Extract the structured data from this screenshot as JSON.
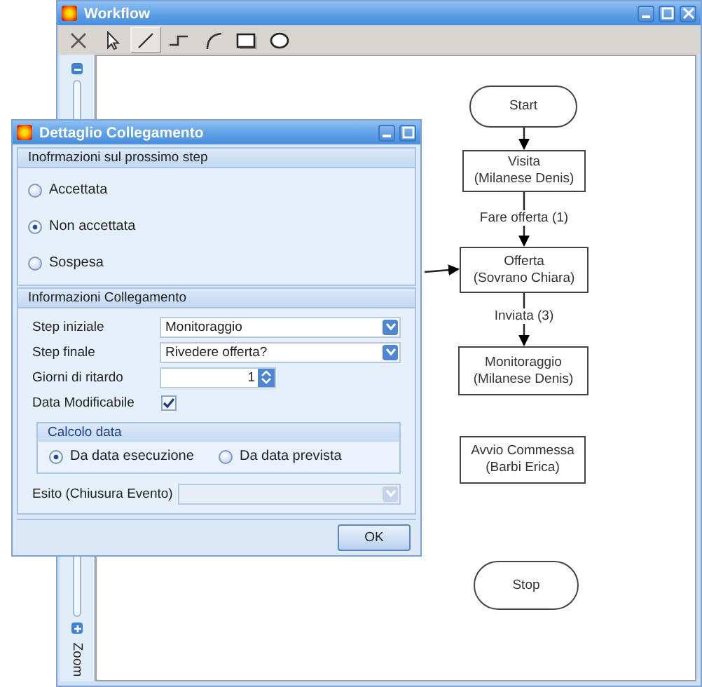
{
  "workflow": {
    "title": "Workflow",
    "tools": [
      {
        "kind": "delete",
        "selected": false
      },
      {
        "kind": "pointer",
        "selected": false
      },
      {
        "kind": "line",
        "selected": true
      },
      {
        "kind": "elbow",
        "selected": false
      },
      {
        "kind": "arc",
        "selected": false
      },
      {
        "kind": "rectangle",
        "selected": false
      },
      {
        "kind": "ellipse",
        "selected": false
      }
    ],
    "zoom_label": "Zoom",
    "flowchart": {
      "nodes": [
        {
          "kind": "terminal",
          "label": "Start"
        },
        {
          "kind": "process",
          "label": "Visita\n(Milanese Denis)"
        },
        {
          "kind": "process",
          "label": "Offerta\n(Sovrano Chiara)"
        },
        {
          "kind": "process",
          "label": "Monitoraggio\n(Milanese Denis)"
        },
        {
          "kind": "process",
          "label": "Avvio Commessa\n(Barbi Erica)"
        },
        {
          "kind": "terminal",
          "label": "Stop"
        }
      ],
      "edge_labels": [
        "Fare offerta (1)",
        "Inviata (3)"
      ]
    }
  },
  "dialog": {
    "title": "Dettaglio Collegamento",
    "next_step": {
      "title": "Inofrmazioni sul prossimo step",
      "options": [
        {
          "label": "Accettata",
          "selected": false
        },
        {
          "label": "Non accettata",
          "selected": true
        },
        {
          "label": "Sospesa",
          "selected": false
        }
      ]
    },
    "link_info": {
      "title": "Informazioni Collegamento",
      "fields": [
        {
          "kind": "combo",
          "label": "Step iniziale",
          "value": "Monitoraggio",
          "disabled": false
        },
        {
          "kind": "combo",
          "label": "Step finale",
          "value": "Rivedere offerta?",
          "disabled": false
        },
        {
          "kind": "spinner",
          "label": "Giorni di ritardo",
          "value": "1"
        },
        {
          "kind": "checkbox",
          "label": "Data Modificabile",
          "checked": true
        }
      ],
      "date_calc": {
        "title": "Calcolo data",
        "options": [
          {
            "label": "Da data esecuzione",
            "selected": true
          },
          {
            "label": "Da data prevista",
            "selected": false
          }
        ]
      },
      "outcome": {
        "kind": "combo",
        "label": "Esito (Chiusura Evento)",
        "disabled": true
      }
    },
    "buttons": [
      "OK"
    ]
  }
}
